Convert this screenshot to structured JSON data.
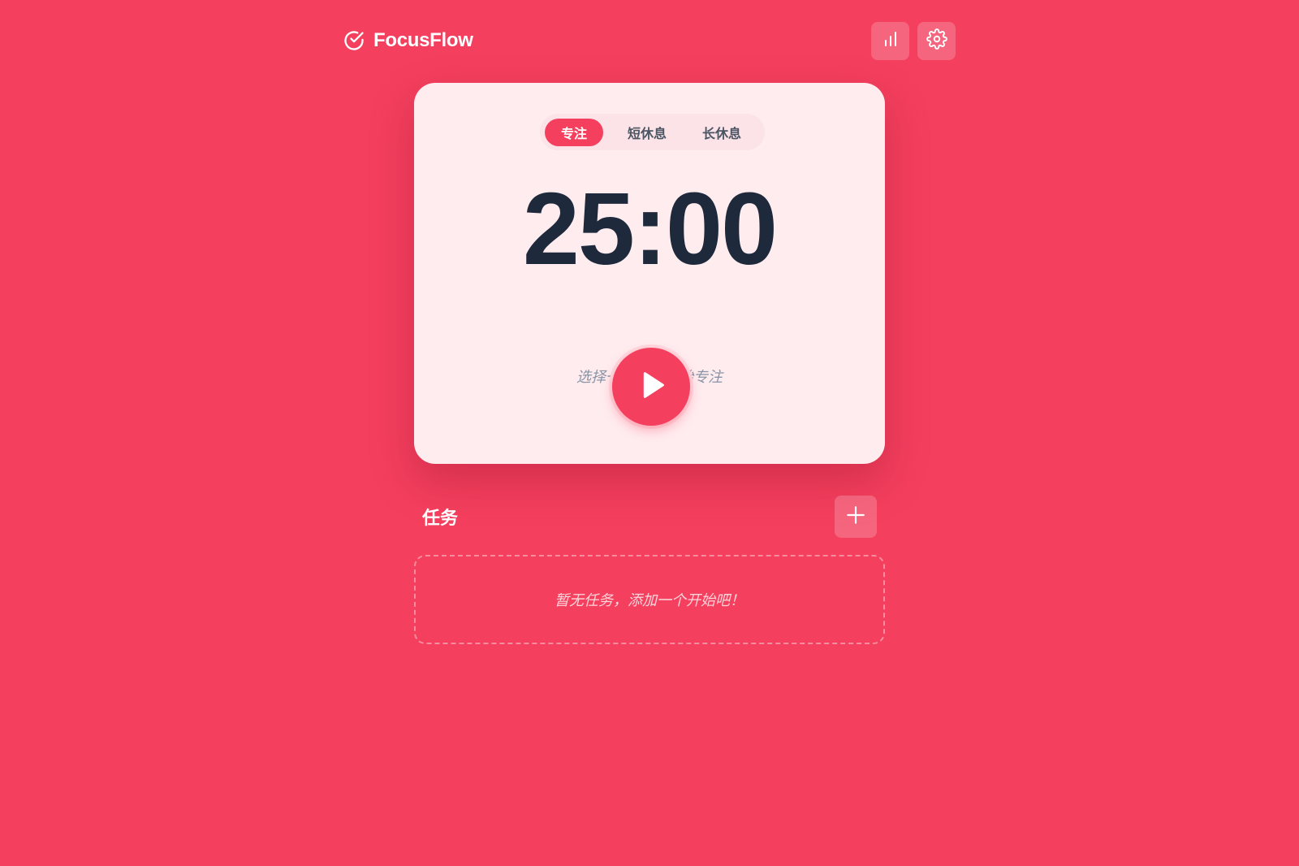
{
  "colors": {
    "background": "#f43f5e",
    "card": "#ffecef",
    "accent": "#f43f5e",
    "time_text": "#1e293b"
  },
  "header": {
    "brand_icon": "check-circle-icon",
    "brand_name": "FocusFlow",
    "actions": [
      {
        "icon": "bar-chart-icon"
      },
      {
        "icon": "gear-icon"
      }
    ]
  },
  "timer": {
    "modes": [
      {
        "label": "专注",
        "active": true
      },
      {
        "label": "短休息",
        "active": false
      },
      {
        "label": "长休息",
        "active": false
      }
    ],
    "time": "25:00",
    "hint": "选择一个任务开始专注",
    "play_icon": "play-icon"
  },
  "tasks": {
    "title": "任务",
    "add_icon": "plus-icon",
    "empty_text": "暂无任务，添加一个开始吧！"
  }
}
